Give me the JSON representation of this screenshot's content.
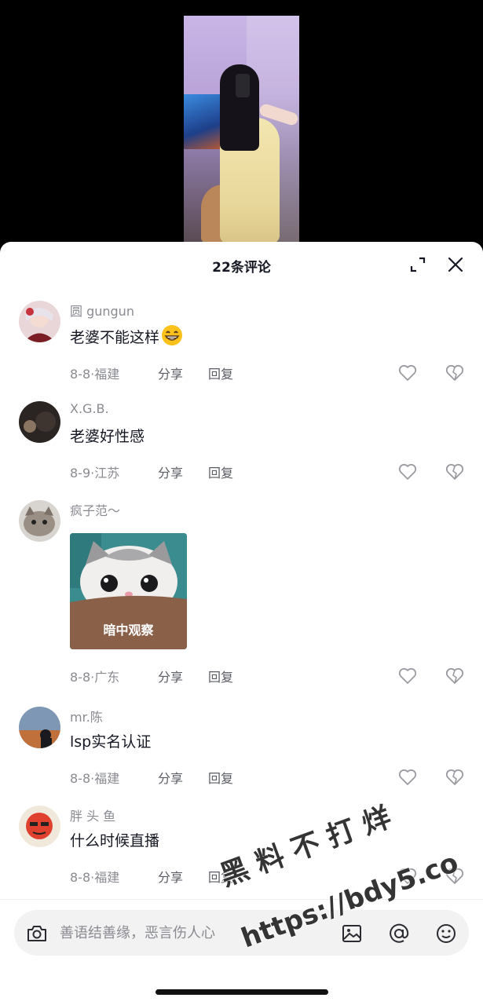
{
  "panel": {
    "title": "22条评论"
  },
  "comments": [
    {
      "user": "圆 gungun",
      "text": "老婆不能这样",
      "date": "8-8",
      "location": "福建",
      "share": "分享",
      "reply": "回复",
      "emoji": "grinning-face-emoji"
    },
    {
      "user": "X.G.B.",
      "text": "老婆好性感",
      "date": "8-9",
      "location": "江苏",
      "share": "分享",
      "reply": "回复"
    },
    {
      "user": "疯子范～",
      "sticker_label": "暗中观察",
      "date": "8-8",
      "location": "广东",
      "share": "分享",
      "reply": "回复"
    },
    {
      "user": "mr.陈",
      "text": "lsp实名认证",
      "date": "8-8",
      "location": "福建",
      "share": "分享",
      "reply": "回复"
    },
    {
      "user": "胖 头 鱼",
      "text": "什么时候直播",
      "date": "8-8",
      "location": "福建",
      "share": "分享",
      "reply": "回复"
    }
  ],
  "input": {
    "placeholder": "善语结善缘，恶言伤人心"
  },
  "watermark": {
    "line1": "黑料不打烊",
    "line2": "https://bdy5.co"
  },
  "icons": [
    "expand-icon",
    "close-icon",
    "heart-icon",
    "broken-heart-icon",
    "camera-icon",
    "image-icon",
    "at-icon",
    "emoji-icon"
  ]
}
